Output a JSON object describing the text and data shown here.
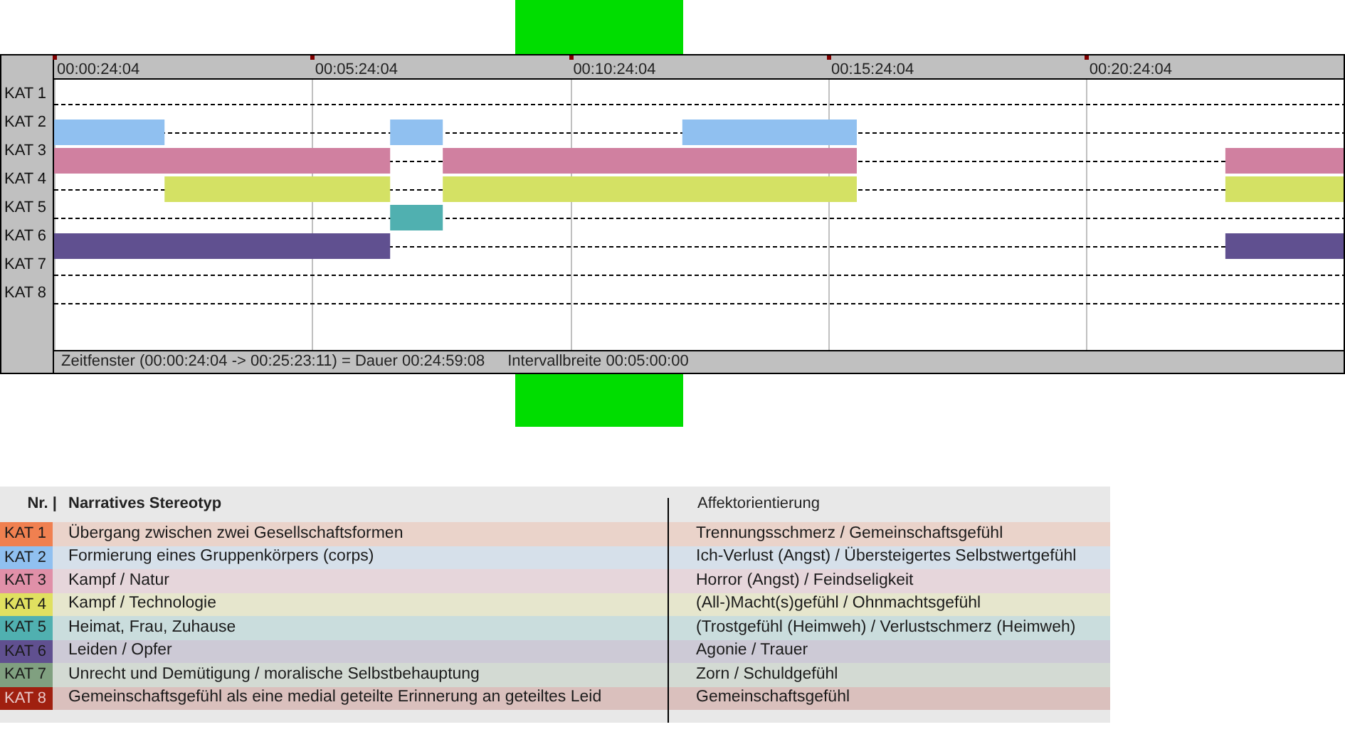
{
  "timeline": {
    "ticks": [
      "00:00:24:04",
      "00:05:24:04",
      "00:10:24:04",
      "00:15:24:04",
      "00:20:24:04"
    ],
    "rows": [
      "KAT 1",
      "KAT 2",
      "KAT 3",
      "KAT 4",
      "KAT 5",
      "KAT 6",
      "KAT 7",
      "KAT 8"
    ],
    "status": "Zeitfenster (00:00:24:04 -> 00:25:23:11) = Dauer 00:24:59:08",
    "interval": "Intervallbreite 00:05:00:00"
  },
  "legend": {
    "columns": [
      "Nr. |",
      "Narratives Stereotyp",
      "Affektorientierung"
    ],
    "rows": [
      {
        "label": "KAT 1",
        "color": "#f08050",
        "stereotype": "Übergang zwischen zwei Gesellschaftsformen",
        "affect": "Trennungsschmerz / Gemeinschaftsgefühl"
      },
      {
        "label": "KAT 2",
        "color": "#90c0f0",
        "stereotype": "Formierung eines Gruppenkörpers (corps)",
        "affect": "Ich-Verlust (Angst) / Übersteigertes Selbstwertgefühl"
      },
      {
        "label": "KAT 3",
        "color": "#e090a8",
        "stereotype": "Kampf / Natur",
        "affect": "Horror (Angst) / Feindseligkeit"
      },
      {
        "label": "KAT 4",
        "color": "#e0e060",
        "stereotype": "Kampf / Technologie",
        "affect": "(All-)Macht(s)gefühl / Ohnmachtsgefühl"
      },
      {
        "label": "KAT 5",
        "color": "#50b0b0",
        "stereotype": "Heimat, Frau, Zuhause",
        "affect": "(Trostgefühl (Heimweh) / Verlustschmerz (Heimweh)"
      },
      {
        "label": "KAT 6",
        "color": "#605090",
        "stereotype": "Leiden / Opfer",
        "affect": "Agonie / Trauer"
      },
      {
        "label": "KAT 7",
        "color": "#80a080",
        "stereotype": "Unrecht und Demütigung / moralische Selbstbehauptung",
        "affect": "Zorn / Schuldgefühl"
      },
      {
        "label": "KAT 8",
        "color": "#a02010",
        "stereotype": "Gemeinschaftsgefühl als eine medial geteilte Erinnerung an geteiltes Leid",
        "affect": "Gemeinschaftsgefühl"
      }
    ]
  }
}
